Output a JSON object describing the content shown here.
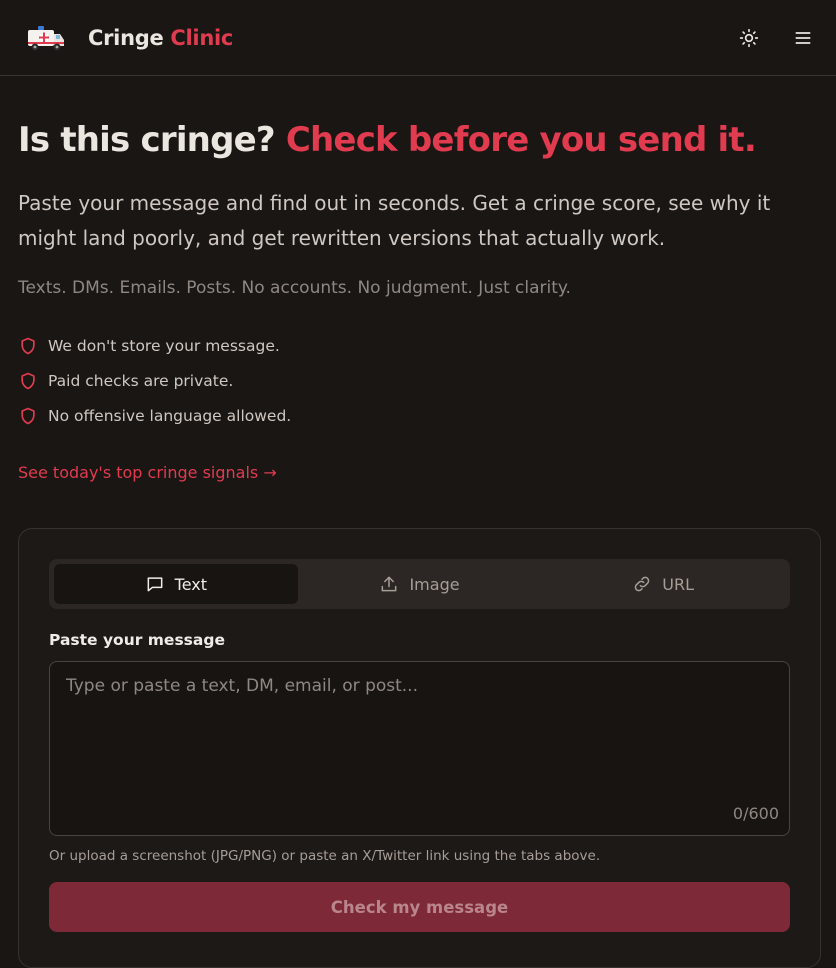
{
  "header": {
    "brand_main": "Cringe",
    "brand_accent": "Clinic",
    "logo_icon": "ambulance-icon",
    "theme_icon": "sun-icon",
    "menu_icon": "hamburger-menu-icon"
  },
  "hero": {
    "title_plain": "Is this cringe?",
    "title_highlight": "Check before you send it.",
    "lead": "Paste your message and find out in seconds. Get a cringe score, see why it might land poorly, and get rewritten versions that actually work.",
    "sub": "Texts. DMs. Emails. Posts. No accounts. No judgment. Just clarity."
  },
  "trust": [
    {
      "text": "We don't store your message.",
      "icon": "shield-icon"
    },
    {
      "text": "Paid checks are private.",
      "icon": "shield-icon"
    },
    {
      "text": "No offensive language allowed.",
      "icon": "shield-icon"
    }
  ],
  "signals_link": "See today's top cringe signals →",
  "form": {
    "tabs": [
      {
        "label": "Text",
        "icon": "message-icon",
        "active": true
      },
      {
        "label": "Image",
        "icon": "upload-icon",
        "active": false
      },
      {
        "label": "URL",
        "icon": "link-icon",
        "active": false
      }
    ],
    "field_label": "Paste your message",
    "placeholder": "Type or paste a text, DM, email, or post...",
    "value": "",
    "counter": "0/600",
    "helper": "Or upload a screenshot (JPG/PNG) or paste an X/Twitter link using the tabs above.",
    "submit_label": "Check my message"
  },
  "colors": {
    "accent": "#e13b50",
    "background": "#1a1614",
    "button_disabled": "#7e2937"
  }
}
